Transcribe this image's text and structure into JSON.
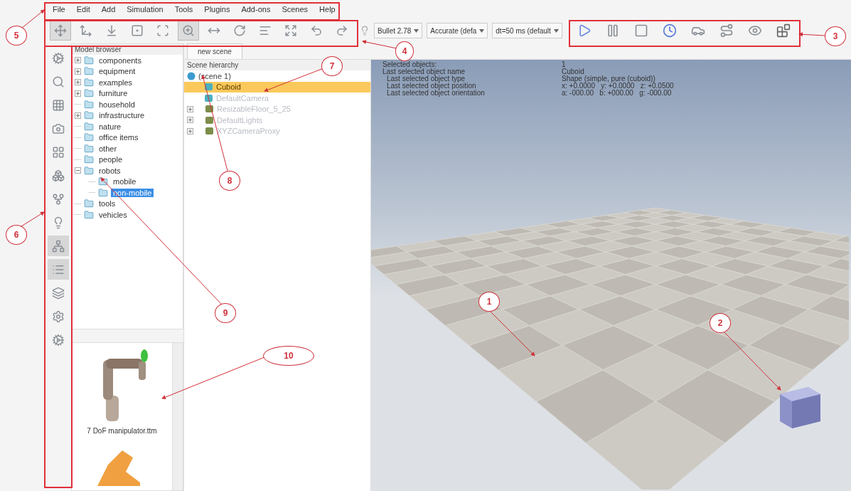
{
  "menu": [
    "File",
    "Edit",
    "Add",
    "Simulation",
    "Tools",
    "Plugins",
    "Add-ons",
    "Scenes",
    "Help"
  ],
  "toolbar": [
    {
      "selected": true
    },
    {
      "selected": false
    },
    {
      "selected": false
    },
    {
      "selected": false
    },
    {
      "selected": false
    },
    {
      "selected": true
    },
    {
      "selected": false
    },
    {
      "selected": false
    },
    {
      "selected": false
    },
    {
      "selected": false
    },
    {
      "selected": false
    },
    {
      "selected": false
    }
  ],
  "engine": [
    "Bullet 2.78",
    "Accurate (defa",
    "dt=50 ms (default"
  ],
  "simulation_toolbar": [
    {
      "selected": false
    },
    {
      "selected": false
    },
    {
      "selected": false
    },
    {
      "selected": false
    },
    {
      "selected": false
    },
    {
      "selected": false
    },
    {
      "selected": false
    },
    {
      "selected": false
    }
  ],
  "side_toolbar": [
    {
      "selected": false
    },
    {
      "selected": false
    },
    {
      "selected": false
    },
    {
      "selected": false
    },
    {
      "selected": false
    },
    {
      "selected": false
    },
    {
      "selected": false
    },
    {
      "selected": false
    },
    {
      "selected": true
    },
    {
      "selected": true
    },
    {
      "selected": false
    },
    {
      "selected": false
    },
    {
      "selected": false
    }
  ],
  "model_browser": {
    "title": "Model browser",
    "items": [
      {
        "label": "components",
        "kind": "collapsed",
        "selected": false
      },
      {
        "label": "equipment",
        "kind": "collapsed",
        "selected": false
      },
      {
        "label": "examples",
        "kind": "collapsed",
        "selected": false
      },
      {
        "label": "furniture",
        "kind": "collapsed",
        "selected": false
      },
      {
        "label": "household",
        "kind": "leaf",
        "selected": false
      },
      {
        "label": "infrastructure",
        "kind": "collapsed",
        "selected": false
      },
      {
        "label": "nature",
        "kind": "leaf",
        "selected": false
      },
      {
        "label": "office items",
        "kind": "leaf",
        "selected": false
      },
      {
        "label": "other",
        "kind": "leaf",
        "selected": false
      },
      {
        "label": "people",
        "kind": "leaf",
        "selected": false
      },
      {
        "label": "robots",
        "kind": "expanded",
        "selected": false,
        "children": [
          {
            "label": "mobile",
            "kind": "leaf",
            "selected": false
          },
          {
            "label": "non-mobile",
            "kind": "leaf",
            "selected": true
          }
        ]
      },
      {
        "label": "tools",
        "kind": "leaf",
        "selected": false
      },
      {
        "label": "vehicles",
        "kind": "leaf",
        "selected": false
      }
    ],
    "thumbnails": [
      {
        "label": "7 DoF manipulator.ttm",
        "kind": "arm"
      },
      {
        "kind": "industrial"
      }
    ]
  },
  "scene_tab": {
    "label": "new scene",
    "selected": true
  },
  "scene_hierarchy": {
    "title": "Scene hierarchy",
    "items": [
      {
        "label": "(scene 1)",
        "kind": "scene",
        "selected": false
      },
      {
        "label": "Cuboid",
        "kind": "object",
        "selected": true
      },
      {
        "label": "DefaultCamera",
        "kind": "object",
        "selected": false
      },
      {
        "label": "ResizableFloor_5_25",
        "kind": "group",
        "selected": false
      },
      {
        "label": "DefaultLights",
        "kind": "group",
        "selected": false
      },
      {
        "label": "XYZCameraProxy",
        "kind": "group",
        "selected": false
      }
    ]
  },
  "info": [
    {
      "label": "Selected objects:",
      "value": "1"
    },
    {
      "label": "Last selected object name",
      "value": "Cuboid"
    },
    {
      "label": "Last selected object type",
      "value": "Shape (simple, pure (cuboid))"
    },
    {
      "label": "Last selected object position",
      "value": "x: +0.0000   y: +0.0000   z: +0.0500"
    },
    {
      "label": "Last selected object orientation",
      "value": "a: -000.00   b: +000.00   g: -000.00"
    }
  ],
  "callouts": [
    {
      "label": "5"
    },
    {
      "label": "4"
    },
    {
      "label": "3"
    },
    {
      "label": "6"
    },
    {
      "label": "7"
    },
    {
      "label": "8"
    },
    {
      "label": "9"
    },
    {
      "label": "10"
    },
    {
      "label": "1"
    },
    {
      "label": "2"
    }
  ]
}
